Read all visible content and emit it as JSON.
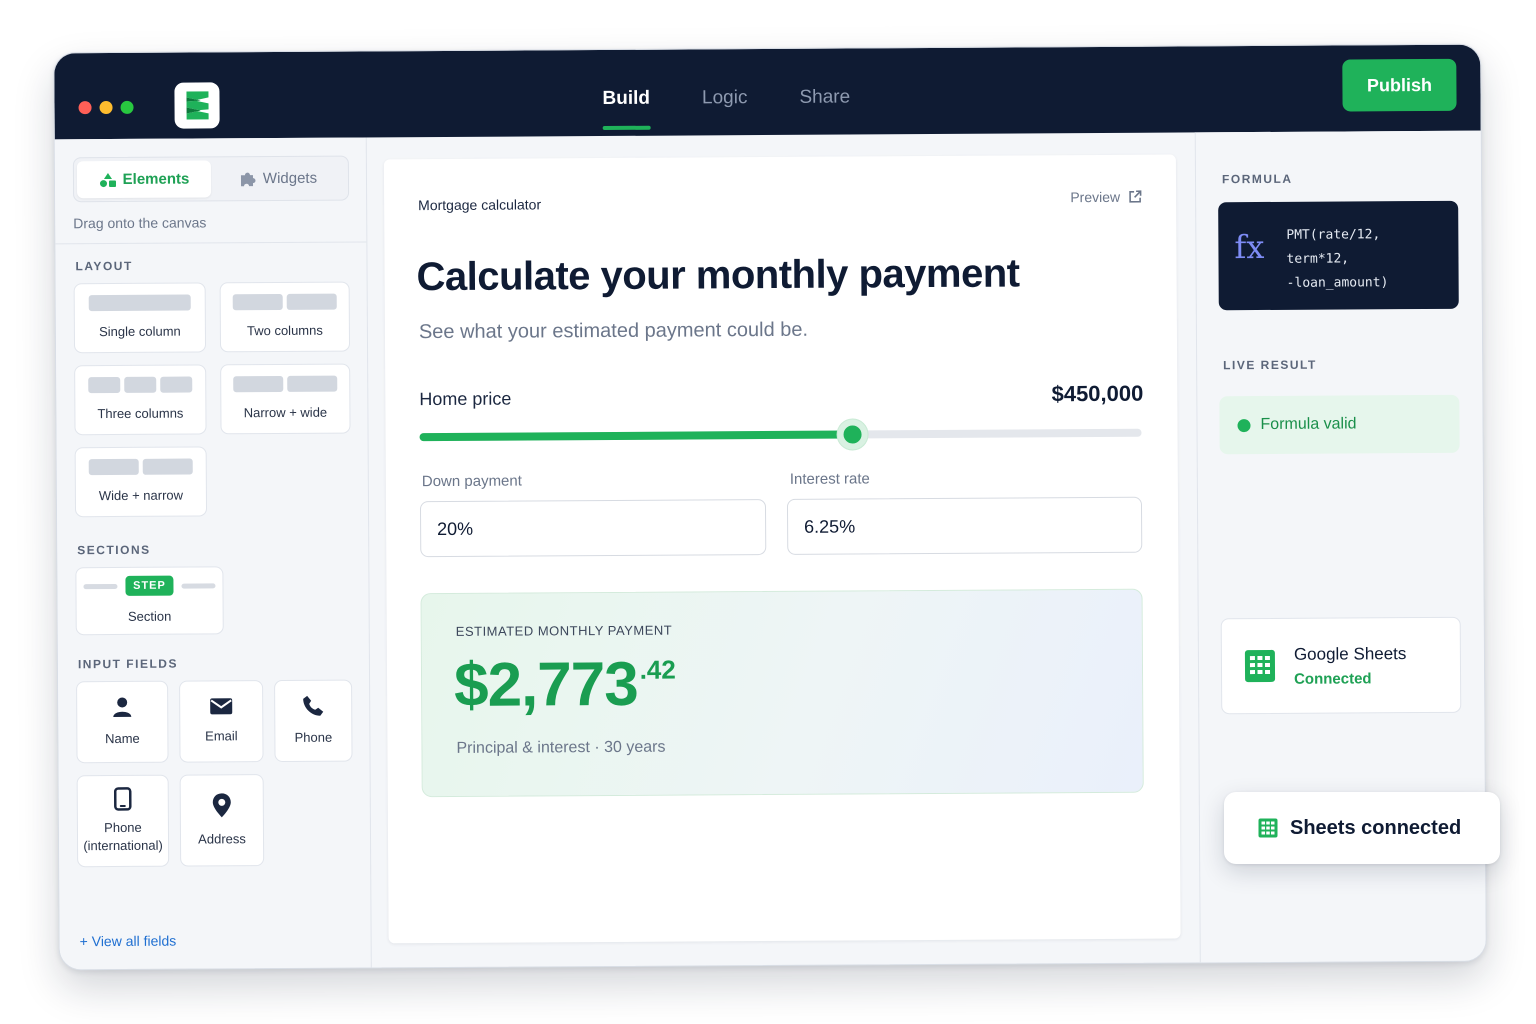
{
  "nav": {
    "tabs": [
      "Build",
      "Logic",
      "Share"
    ],
    "active": 0,
    "publish_label": "Publish"
  },
  "colors": {
    "accent": "#1fb25a",
    "navy": "#0f1b33",
    "link": "#1f6fd1",
    "formula_fx": "#7e8cf5"
  },
  "left_panel": {
    "tabs": [
      {
        "label": "Elements",
        "icon": "shapes-icon"
      },
      {
        "label": "Widgets",
        "icon": "puzzle-icon"
      }
    ],
    "hint": "Drag onto the canvas",
    "layout_title": "LAYOUT",
    "layouts": [
      "Single column",
      "Two columns",
      "Three columns",
      "Narrow + wide",
      "Wide + narrow"
    ],
    "sections_title": "SECTIONS",
    "section_badge": "STEP",
    "section_label": "Section",
    "input_fields_title": "INPUT FIELDS",
    "fields": [
      {
        "label": "Name",
        "icon": "user-icon"
      },
      {
        "label": "Email",
        "icon": "envelope-icon"
      },
      {
        "label": "Phone",
        "icon": "phone-icon"
      },
      {
        "label": "Phone (international)",
        "icon": "mobile-icon"
      },
      {
        "label": "Address",
        "icon": "map-pin-icon"
      }
    ],
    "view_all": "+ View all fields"
  },
  "canvas": {
    "form_name": "Mortgage calculator",
    "preview_label": "Preview",
    "headline": "Calculate your monthly payment",
    "subheadline": "See what your estimated payment could be.",
    "home_price_label": "Home price",
    "home_price_value": "$450,000",
    "home_price_slider_fraction": 0.6,
    "down_payment_label": "Down payment",
    "down_payment_value": "20%",
    "interest_rate_label": "Interest rate",
    "interest_rate_value": "6.25%",
    "result": {
      "label": "ESTIMATED MONTHLY PAYMENT",
      "amount_main": "$2,773",
      "amount_cents": ".42",
      "subtitle": "Principal & interest · 30 years"
    }
  },
  "right_panel": {
    "formula_title": "FORMULA",
    "fx_symbol": "fx",
    "formula_code": "PMT(rate/12,\nterm*12,\n-loan_amount)",
    "live_result_title": "LIVE RESULT",
    "status": "Formula valid",
    "integration_name": "Google Sheets",
    "integration_status": "Connected"
  },
  "toast": {
    "message": "Sheets connected"
  }
}
